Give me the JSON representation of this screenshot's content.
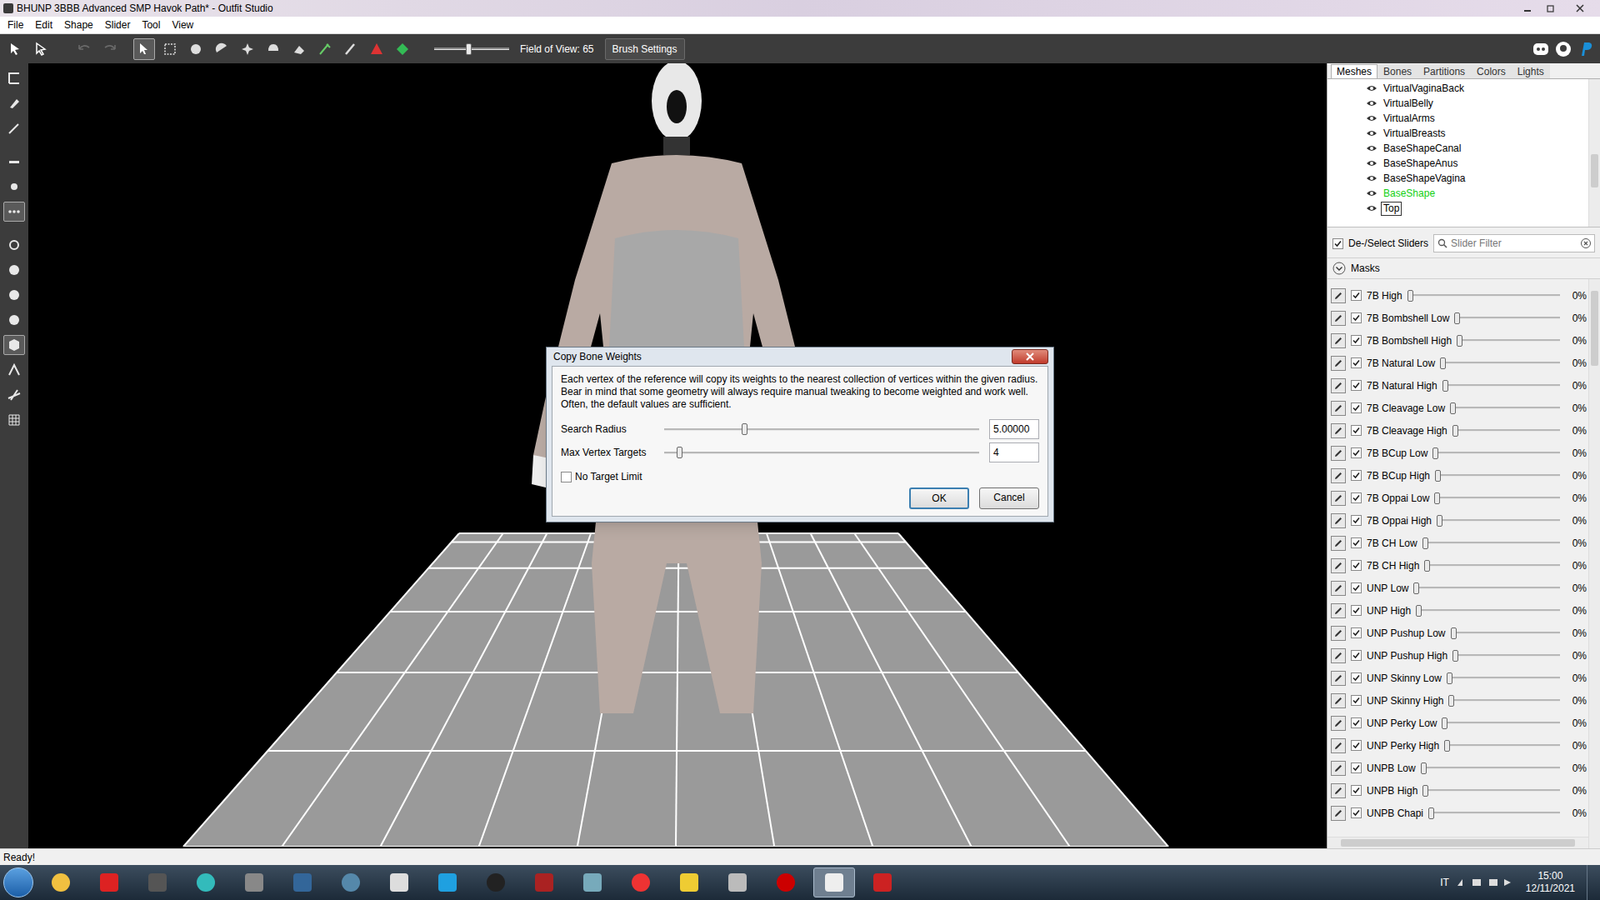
{
  "window": {
    "title": "BHUNP 3BBB Advanced SMP Havok Path* - Outfit Studio"
  },
  "menu": [
    "File",
    "Edit",
    "Shape",
    "Slider",
    "Tool",
    "View"
  ],
  "toolbar": {
    "tools": [
      {
        "selected": false,
        "disabled": false
      },
      {
        "selected": false,
        "disabled": false
      },
      {
        "selected": false,
        "disabled": true
      },
      {
        "selected": false,
        "disabled": true
      },
      {
        "selected": true,
        "disabled": false
      },
      {
        "selected": false,
        "disabled": false
      },
      {
        "selected": false,
        "disabled": false
      },
      {
        "selected": false,
        "disabled": false
      },
      {
        "selected": false,
        "disabled": false
      },
      {
        "selected": false,
        "disabled": false
      },
      {
        "selected": false,
        "disabled": false
      },
      {
        "selected": false,
        "disabled": false
      },
      {
        "selected": false,
        "disabled": false
      },
      {
        "selected": false,
        "disabled": false
      },
      {
        "selected": false,
        "disabled": false
      }
    ],
    "fov_slider": {
      "level": 0.46
    },
    "fov_label": "Field of View: 65",
    "brush_settings": "Brush Settings"
  },
  "left_tools": [
    {
      "selected": false
    },
    {
      "selected": false
    },
    {
      "selected": false
    },
    {
      "selected": false
    },
    {
      "selected": false
    },
    {
      "selected": true
    },
    {
      "selected": false
    },
    {
      "selected": false
    },
    {
      "selected": false
    },
    {
      "selected": false
    },
    {
      "selected": true
    },
    {
      "selected": false
    },
    {
      "selected": false
    },
    {
      "selected": false
    }
  ],
  "panel": {
    "tabs": [
      {
        "label": "Meshes",
        "selected": true
      },
      {
        "label": "Bones",
        "selected": false
      },
      {
        "label": "Partitions",
        "selected": false
      },
      {
        "label": "Colors",
        "selected": false
      },
      {
        "label": "Lights",
        "selected": false
      }
    ],
    "meshes": [
      {
        "name": "VirtualVaginaBack",
        "visible": true,
        "selected": false,
        "reference": false
      },
      {
        "name": "VirtualBelly",
        "visible": true,
        "selected": false,
        "reference": false
      },
      {
        "name": "VirtualArms",
        "visible": true,
        "selected": false,
        "reference": false
      },
      {
        "name": "VirtualBreasts",
        "visible": true,
        "selected": false,
        "reference": false
      },
      {
        "name": "BaseShapeCanal",
        "visible": true,
        "selected": false,
        "reference": false
      },
      {
        "name": "BaseShapeAnus",
        "visible": true,
        "selected": false,
        "reference": false
      },
      {
        "name": "BaseShapeVagina",
        "visible": true,
        "selected": false,
        "reference": false
      },
      {
        "name": "BaseShape",
        "visible": true,
        "selected": false,
        "reference": true
      },
      {
        "name": "Top",
        "visible": true,
        "selected": true,
        "reference": false
      }
    ],
    "deselect_sliders": {
      "label": "De-/Select Sliders",
      "checked": true
    },
    "filter": {
      "placeholder": "Slider Filter"
    },
    "group": {
      "label": "Masks",
      "expanded": true
    },
    "sliders": [
      {
        "name": "7B High",
        "checked": true,
        "level": 0,
        "value": "0%"
      },
      {
        "name": "7B Bombshell Low",
        "checked": true,
        "level": 0,
        "value": "0%"
      },
      {
        "name": "7B Bombshell High",
        "checked": true,
        "level": 0,
        "value": "0%"
      },
      {
        "name": "7B Natural Low",
        "checked": true,
        "level": 0,
        "value": "0%"
      },
      {
        "name": "7B Natural High",
        "checked": true,
        "level": 0,
        "value": "0%"
      },
      {
        "name": "7B Cleavage Low",
        "checked": true,
        "level": 0,
        "value": "0%"
      },
      {
        "name": "7B Cleavage High",
        "checked": true,
        "level": 0,
        "value": "0%"
      },
      {
        "name": "7B BCup Low",
        "checked": true,
        "level": 0,
        "value": "0%"
      },
      {
        "name": "7B BCup High",
        "checked": true,
        "level": 0,
        "value": "0%"
      },
      {
        "name": "7B Oppai Low",
        "checked": true,
        "level": 0,
        "value": "0%"
      },
      {
        "name": "7B Oppai High",
        "checked": true,
        "level": 0,
        "value": "0%"
      },
      {
        "name": "7B CH Low",
        "checked": true,
        "level": 0,
        "value": "0%"
      },
      {
        "name": "7B CH High",
        "checked": true,
        "level": 0,
        "value": "0%"
      },
      {
        "name": "UNP Low",
        "checked": true,
        "level": 0,
        "value": "0%"
      },
      {
        "name": "UNP High",
        "checked": true,
        "level": 0,
        "value": "0%"
      },
      {
        "name": "UNP Pushup Low",
        "checked": true,
        "level": 0,
        "value": "0%"
      },
      {
        "name": "UNP Pushup High",
        "checked": true,
        "level": 0,
        "value": "0%"
      },
      {
        "name": "UNP Skinny Low",
        "checked": true,
        "level": 0,
        "value": "0%"
      },
      {
        "name": "UNP Skinny High",
        "checked": true,
        "level": 0,
        "value": "0%"
      },
      {
        "name": "UNP Perky Low",
        "checked": true,
        "level": 0,
        "value": "0%"
      },
      {
        "name": "UNP Perky High",
        "checked": true,
        "level": 0,
        "value": "0%"
      },
      {
        "name": "UNPB Low",
        "checked": true,
        "level": 0,
        "value": "0%"
      },
      {
        "name": "UNPB High",
        "checked": true,
        "level": 0,
        "value": "0%"
      },
      {
        "name": "UNPB Chapi",
        "checked": true,
        "level": 0,
        "value": "0%"
      }
    ]
  },
  "dialog": {
    "title": "Copy Bone Weights",
    "text": "Each vertex of the reference will copy its weights to the nearest collection of vertices within the given radius. Bear in mind that some geometry will always require manual tweaking to become weighted and work well. Often, the default values are sufficient.",
    "fields": [
      {
        "label": "Search Radius",
        "level": 0.25,
        "value": "5.00000"
      },
      {
        "label": "Max Vertex Targets",
        "level": 0.04,
        "value": "4"
      }
    ],
    "checkbox": {
      "label": "No Target Limit",
      "checked": false
    },
    "buttons": [
      {
        "label": "OK",
        "default": true
      },
      {
        "label": "Cancel",
        "default": false
      }
    ]
  },
  "status_bar": "Ready!",
  "taskbar": {
    "apps": [
      {
        "active": false
      },
      {
        "active": false
      },
      {
        "active": false
      },
      {
        "active": false
      },
      {
        "active": false
      },
      {
        "active": false
      },
      {
        "active": false
      },
      {
        "active": false
      },
      {
        "active": false
      },
      {
        "active": false
      },
      {
        "active": false
      },
      {
        "active": false
      },
      {
        "active": false
      },
      {
        "active": false
      },
      {
        "active": false
      },
      {
        "active": false
      },
      {
        "active": true
      },
      {
        "active": false
      }
    ],
    "language": "IT",
    "time": "15:00",
    "date": "12/11/2021"
  }
}
